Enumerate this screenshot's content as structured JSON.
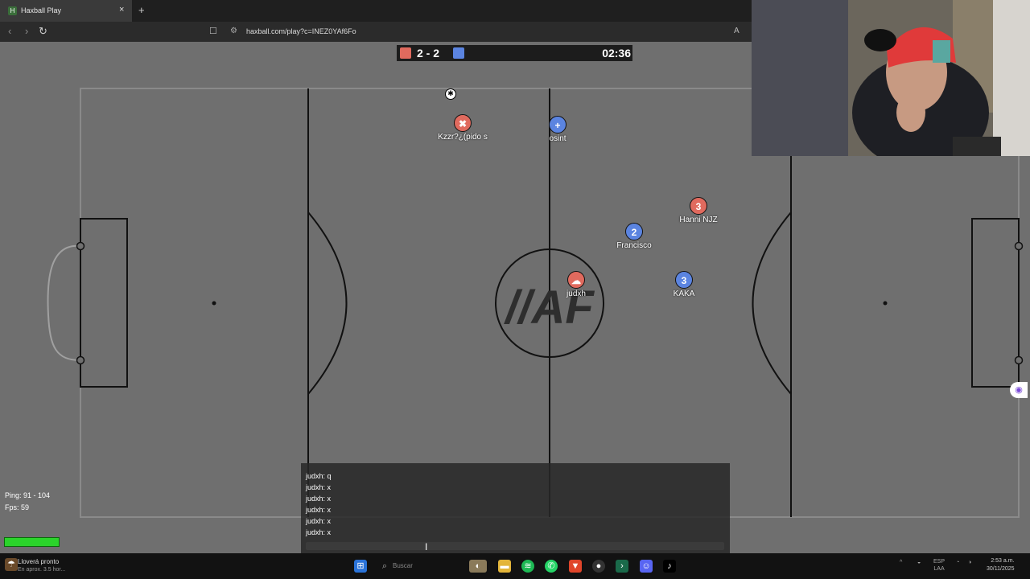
{
  "browser": {
    "tab_title": "Haxball Play",
    "tab_favicon": "H",
    "close_icon": "×",
    "new_tab_icon": "+",
    "url": "haxball.com/play?c=INEZ0YAf6Fo"
  },
  "scoreboard": {
    "score": "2 - 2",
    "timer": "02:36",
    "red_color": "#e06a5e",
    "blue_color": "#5b84e0"
  },
  "players": [
    {
      "name": "Kzzr?¿(pido s",
      "avatar": "✖",
      "team": "red"
    },
    {
      "name": "osint",
      "avatar": "+",
      "team": "blue"
    },
    {
      "name": "Hanni NJZ",
      "avatar": "3",
      "team": "red"
    },
    {
      "name": "Francisco",
      "avatar": "2",
      "team": "blue"
    },
    {
      "name": "judxh",
      "avatar": "☁",
      "team": "red"
    },
    {
      "name": "KAKA",
      "avatar": "3",
      "team": "blue"
    }
  ],
  "field_logo": "//AF",
  "chat": {
    "messages": [
      "judxh: q",
      "judxh: x",
      "judxh: x",
      "judxh: x",
      "judxh: x",
      "judxh: x"
    ]
  },
  "stats": {
    "ping": "Ping: 91 - 104",
    "fps": "Fps: 59"
  },
  "taskbar": {
    "weather_title": "Lloverá pronto",
    "weather_sub": "En aprox. 3.5 hor...",
    "search_placeholder": "Buscar",
    "lang": "ESP",
    "lang_sub": "LAA",
    "time": "2:53 a.m.",
    "date": "30/11/2025"
  }
}
